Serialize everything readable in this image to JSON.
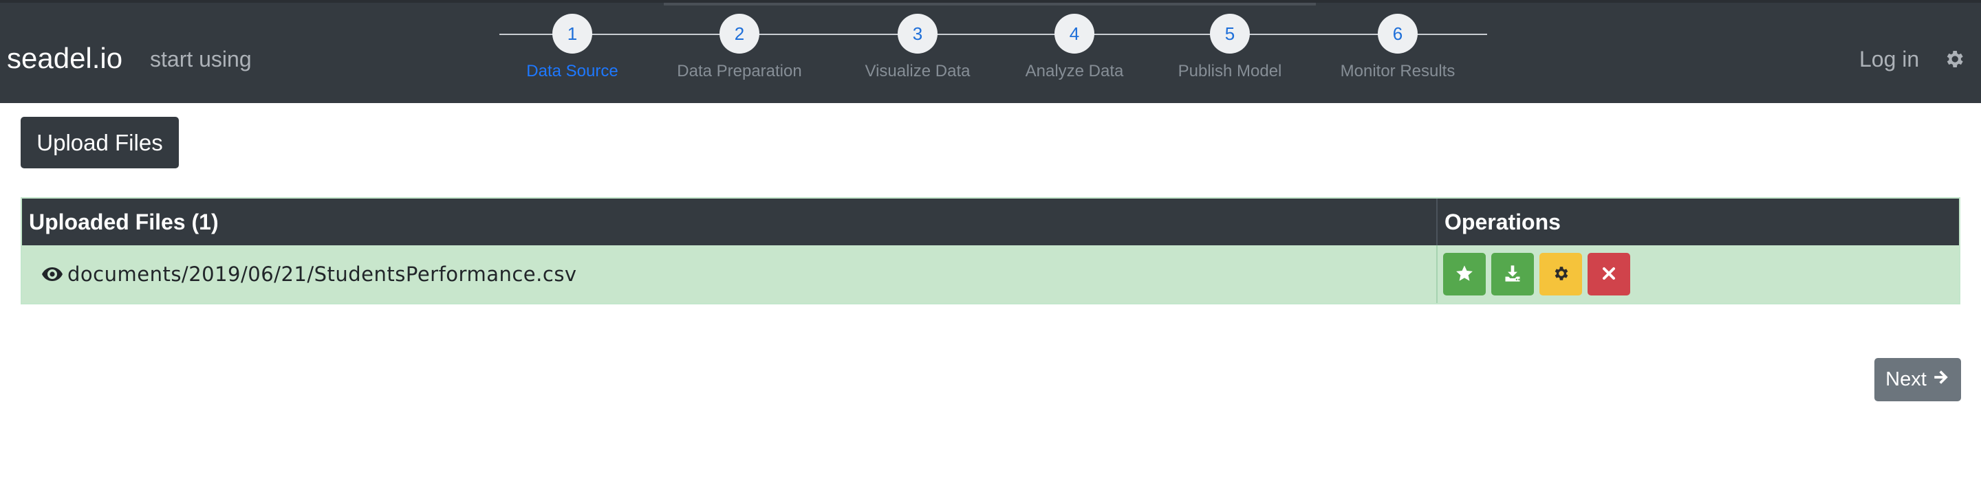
{
  "navbar": {
    "brand": "seadel.io",
    "start_link": "start using",
    "login": "Log in",
    "gear_icon": "gear-icon"
  },
  "steps": [
    {
      "number": "1",
      "label": "Data Source",
      "active": true
    },
    {
      "number": "2",
      "label": "Data Preparation",
      "active": false
    },
    {
      "number": "3",
      "label": "Visualize Data",
      "active": false
    },
    {
      "number": "4",
      "label": "Analyze Data",
      "active": false
    },
    {
      "number": "5",
      "label": "Publish Model",
      "active": false
    },
    {
      "number": "6",
      "label": "Monitor Results",
      "active": false
    }
  ],
  "upload": {
    "label": "Upload Files"
  },
  "table": {
    "headers": [
      "Uploaded Files (1)",
      "Operations"
    ],
    "rows": [
      {
        "filename": "documents/2019/06/21/StudentsPerformance.csv",
        "operations": [
          "star-icon",
          "download-icon",
          "gear-icon",
          "close-icon"
        ]
      }
    ]
  },
  "next": {
    "label": "Next"
  },
  "colors": {
    "navbar": "#343a40",
    "active_step": "#1e78ff",
    "row_success": "#c8e6cc",
    "btn_green": "#55a84d",
    "btn_yellow": "#f5c33b",
    "btn_red": "#d0434b",
    "btn_secondary": "#6c757d"
  }
}
